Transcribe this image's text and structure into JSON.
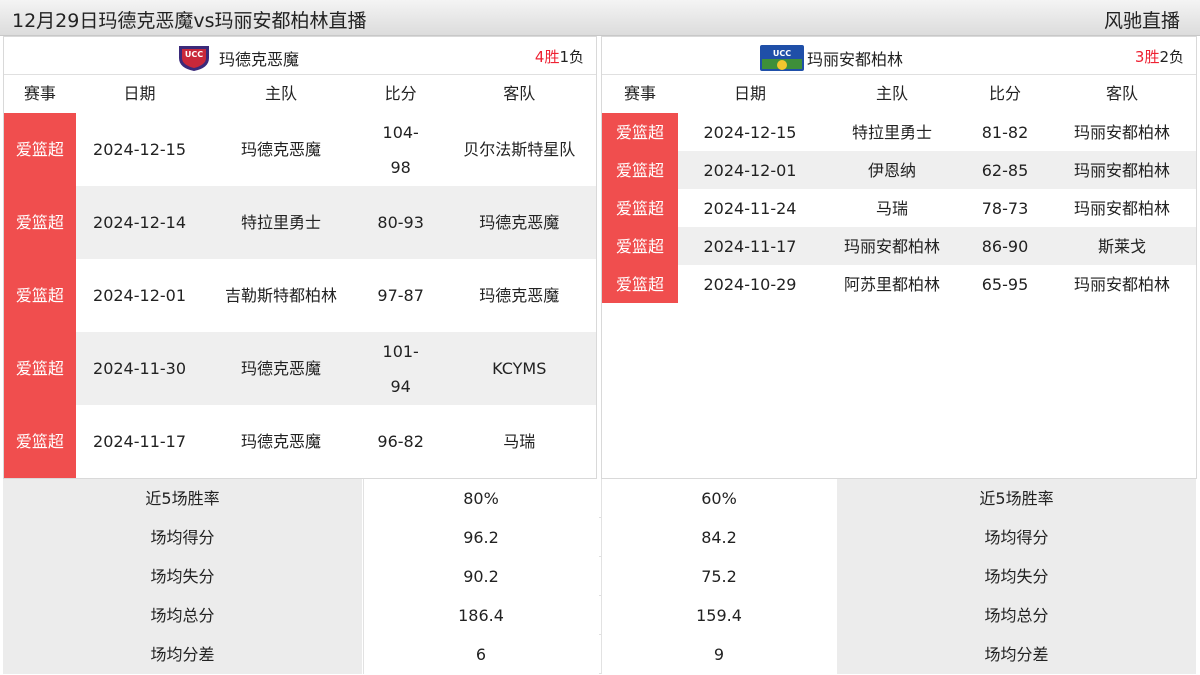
{
  "page": {
    "title": "12月29日玛德克恶魔vs玛丽安都柏林直播",
    "brand": "风驰直播"
  },
  "left": {
    "team": "玛德克恶魔",
    "logo_icon": "team-logo-shield",
    "record_wins": "4胜",
    "record_losses": "1负",
    "headers": [
      "赛事",
      "日期",
      "主队",
      "比分",
      "客队"
    ],
    "rows": [
      {
        "league": "爱篮超",
        "date": "2024-12-15",
        "home": "玛德克恶魔",
        "score": "104-98",
        "away": "贝尔法斯特星队"
      },
      {
        "league": "爱篮超",
        "date": "2024-12-14",
        "home": "特拉里勇士",
        "score": "80-93",
        "away": "玛德克恶魔"
      },
      {
        "league": "爱篮超",
        "date": "2024-12-01",
        "home": "吉勒斯特都柏林",
        "score": "97-87",
        "away": "玛德克恶魔"
      },
      {
        "league": "爱篮超",
        "date": "2024-11-30",
        "home": "玛德克恶魔",
        "score": "101-94",
        "away": "KCYMS"
      },
      {
        "league": "爱篮超",
        "date": "2024-11-17",
        "home": "玛德克恶魔",
        "score": "96-82",
        "away": "马瑞"
      }
    ]
  },
  "right": {
    "team": "玛丽安都柏林",
    "logo_icon": "team-logo-badge",
    "record_wins": "3胜",
    "record_losses": "2负",
    "headers": [
      "赛事",
      "日期",
      "主队",
      "比分",
      "客队"
    ],
    "rows": [
      {
        "league": "爱篮超",
        "date": "2024-12-15",
        "home": "特拉里勇士",
        "score": "81-82",
        "away": "玛丽安都柏林"
      },
      {
        "league": "爱篮超",
        "date": "2024-12-01",
        "home": "伊恩纳",
        "score": "62-85",
        "away": "玛丽安都柏林"
      },
      {
        "league": "爱篮超",
        "date": "2024-11-24",
        "home": "马瑞",
        "score": "78-73",
        "away": "玛丽安都柏林"
      },
      {
        "league": "爱篮超",
        "date": "2024-11-17",
        "home": "玛丽安都柏林",
        "score": "86-90",
        "away": "斯莱戈"
      },
      {
        "league": "爱篮超",
        "date": "2024-10-29",
        "home": "阿苏里都柏林",
        "score": "65-95",
        "away": "玛丽安都柏林"
      }
    ]
  },
  "stats": [
    {
      "label": "近5场胜率",
      "left": "80%",
      "right": "60%"
    },
    {
      "label": "场均得分",
      "left": "96.2",
      "right": "84.2"
    },
    {
      "label": "场均失分",
      "left": "90.2",
      "right": "75.2"
    },
    {
      "label": "场均总分",
      "left": "186.4",
      "right": "159.4"
    },
    {
      "label": "场均分差",
      "left": "6",
      "right": "9"
    }
  ],
  "colors": {
    "league_tag": "#f04e4e",
    "win_red": "#e22233",
    "row_alt": "#efefef"
  }
}
